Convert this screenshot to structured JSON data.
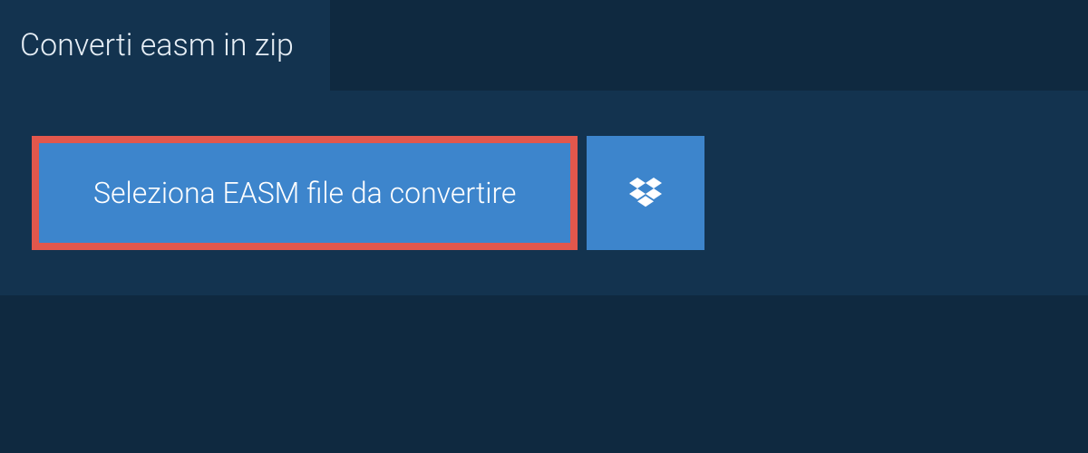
{
  "tab": {
    "title": "Converti easm in zip"
  },
  "buttons": {
    "select_file_label": "Seleziona EASM file da convertire"
  },
  "colors": {
    "background": "#0f2940",
    "panel": "#13334f",
    "button": "#3d85cc",
    "highlight_border": "#e2574c",
    "text": "#ffffff"
  }
}
